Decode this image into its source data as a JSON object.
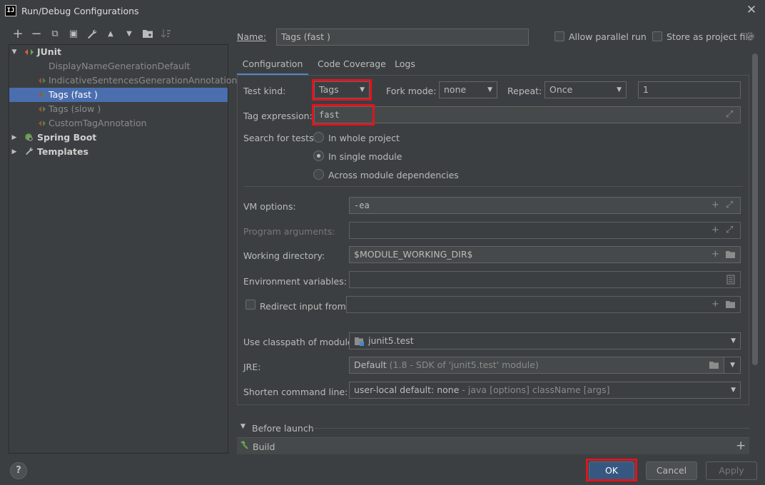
{
  "window": {
    "title": "Run/Debug Configurations",
    "app_icon_text": "IJ"
  },
  "toolbar": {
    "add": "+",
    "remove": "−",
    "copy": "⧉",
    "save": "▣",
    "edit": "🔧",
    "up": "▲",
    "down": "▼",
    "folder": "▆",
    "sort": "↓"
  },
  "tree": {
    "junit": "JUnit",
    "items": [
      {
        "label": "DisplayNameGenerationDefault"
      },
      {
        "label": "IndicativeSentencesGenerationAnnotation"
      },
      {
        "label": "Tags (fast )"
      },
      {
        "label": "Tags (slow )"
      },
      {
        "label": "CustomTagAnnotation"
      }
    ],
    "spring_boot": "Spring Boot",
    "templates": "Templates"
  },
  "header": {
    "name_label": "Name:",
    "name_value": "Tags (fast )",
    "allow_parallel": "Allow parallel run",
    "store_as_file": "Store as project file"
  },
  "tabs": [
    "Configuration",
    "Code Coverage",
    "Logs"
  ],
  "config": {
    "test_kind_label": "Test kind:",
    "test_kind_value": "Tags",
    "fork_mode_label": "Fork mode:",
    "fork_mode_value": "none",
    "repeat_label": "Repeat:",
    "repeat_value": "Once",
    "repeat_count": "1",
    "tag_expr_label": "Tag expression:",
    "tag_expr_value": "fast",
    "search_label": "Search for tests:",
    "search_options": [
      "In whole project",
      "In single module",
      "Across module dependencies"
    ],
    "vm_label": "VM options:",
    "vm_value": "-ea",
    "prog_args_label": "Program arguments:",
    "prog_args_value": "",
    "workdir_label": "Working directory:",
    "workdir_value": "$MODULE_WORKING_DIR$",
    "env_label": "Environment variables:",
    "env_value": "",
    "redirect_label": "Redirect input from:",
    "redirect_value": "",
    "classpath_label": "Use classpath of module:",
    "classpath_value": "junit5.test",
    "jre_label": "JRE:",
    "jre_value": "Default",
    "jre_hint": "(1.8 - SDK of 'junit5.test' module)",
    "shorten_label": "Shorten command line:",
    "shorten_value": "user-local default: none",
    "shorten_hint": "- java [options] className [args]"
  },
  "before_launch": {
    "title": "Before launch",
    "item": "Build"
  },
  "buttons": {
    "ok": "OK",
    "cancel": "Cancel",
    "apply": "Apply",
    "help": "?"
  },
  "colors": {
    "background": "#3c3f41",
    "selection": "#4b6eaf",
    "primary_button": "#365880",
    "highlight_box": "#e0141e"
  }
}
